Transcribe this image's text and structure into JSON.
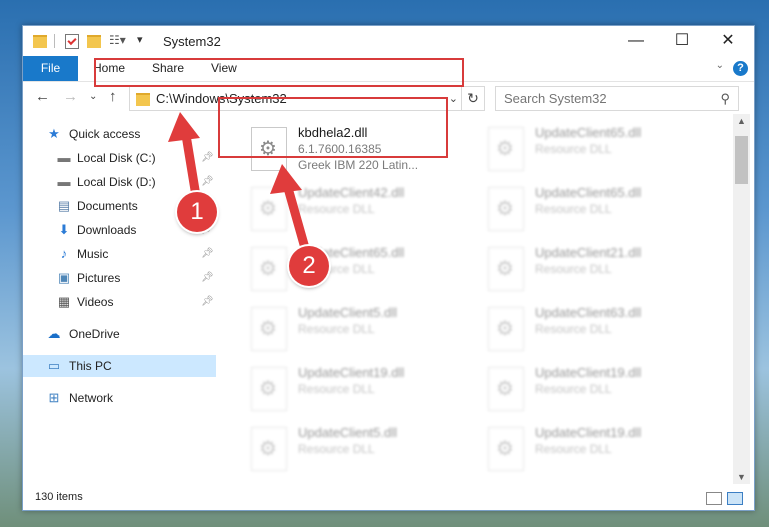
{
  "window": {
    "title": "System32"
  },
  "window_controls": {
    "minimize": "—",
    "maximize": "☐",
    "close": "✕"
  },
  "ribbon": {
    "file_tab": "File",
    "tabs": [
      "Home",
      "Share",
      "View"
    ],
    "help": "?"
  },
  "address": {
    "path": "C:\\Windows\\System32",
    "search_placeholder": "Search System32"
  },
  "sidebar": {
    "items": [
      {
        "label": "Quick access",
        "icon": "star-icon",
        "pinned": false
      },
      {
        "label": "Local Disk (C:)",
        "icon": "drive-icon",
        "pinned": true
      },
      {
        "label": "Local Disk (D:)",
        "icon": "drive-icon",
        "pinned": true
      },
      {
        "label": "Documents",
        "icon": "document-icon",
        "pinned": true
      },
      {
        "label": "Downloads",
        "icon": "download-icon",
        "pinned": true
      },
      {
        "label": "Music",
        "icon": "music-icon",
        "pinned": true
      },
      {
        "label": "Pictures",
        "icon": "pictures-icon",
        "pinned": true
      },
      {
        "label": "Videos",
        "icon": "videos-icon",
        "pinned": true
      },
      {
        "label": "OneDrive",
        "icon": "cloud-icon",
        "pinned": false
      },
      {
        "label": "This PC",
        "icon": "computer-icon",
        "pinned": false,
        "selected": true
      },
      {
        "label": "Network",
        "icon": "network-icon",
        "pinned": false
      }
    ]
  },
  "files": {
    "highlighted": {
      "name": "kbdhela2.dll",
      "version": "6.1.7600.16385",
      "description": "Greek IBM 220 Latin..."
    },
    "blurred": [
      {
        "name": "UpdateClient65.dll",
        "type": "Resource DLL"
      },
      {
        "name": "UpdateClient42.dll",
        "type": "Resource DLL"
      },
      {
        "name": "UpdateClient65.dll",
        "type": "Resource DLL"
      },
      {
        "name": "UpdateClient65.dll",
        "type": "Resource DLL"
      },
      {
        "name": "UpdateClient21.dll",
        "type": "Resource DLL"
      },
      {
        "name": "UpdateClient5.dll",
        "type": "Resource DLL"
      },
      {
        "name": "UpdateClient63.dll",
        "type": "Resource DLL"
      },
      {
        "name": "UpdateClient19.dll",
        "type": "Resource DLL"
      },
      {
        "name": "UpdateClient19.dll",
        "type": "Resource DLL"
      },
      {
        "name": "UpdateClient5.dll",
        "type": "Resource DLL"
      },
      {
        "name": "UpdateClient19.dll",
        "type": "Resource DLL"
      }
    ]
  },
  "status": {
    "item_count": "130 items"
  },
  "callouts": {
    "one": "1",
    "two": "2"
  },
  "colors": {
    "accent": "#1979ca",
    "highlight": "#d83b3b",
    "selection": "#cce8ff"
  }
}
